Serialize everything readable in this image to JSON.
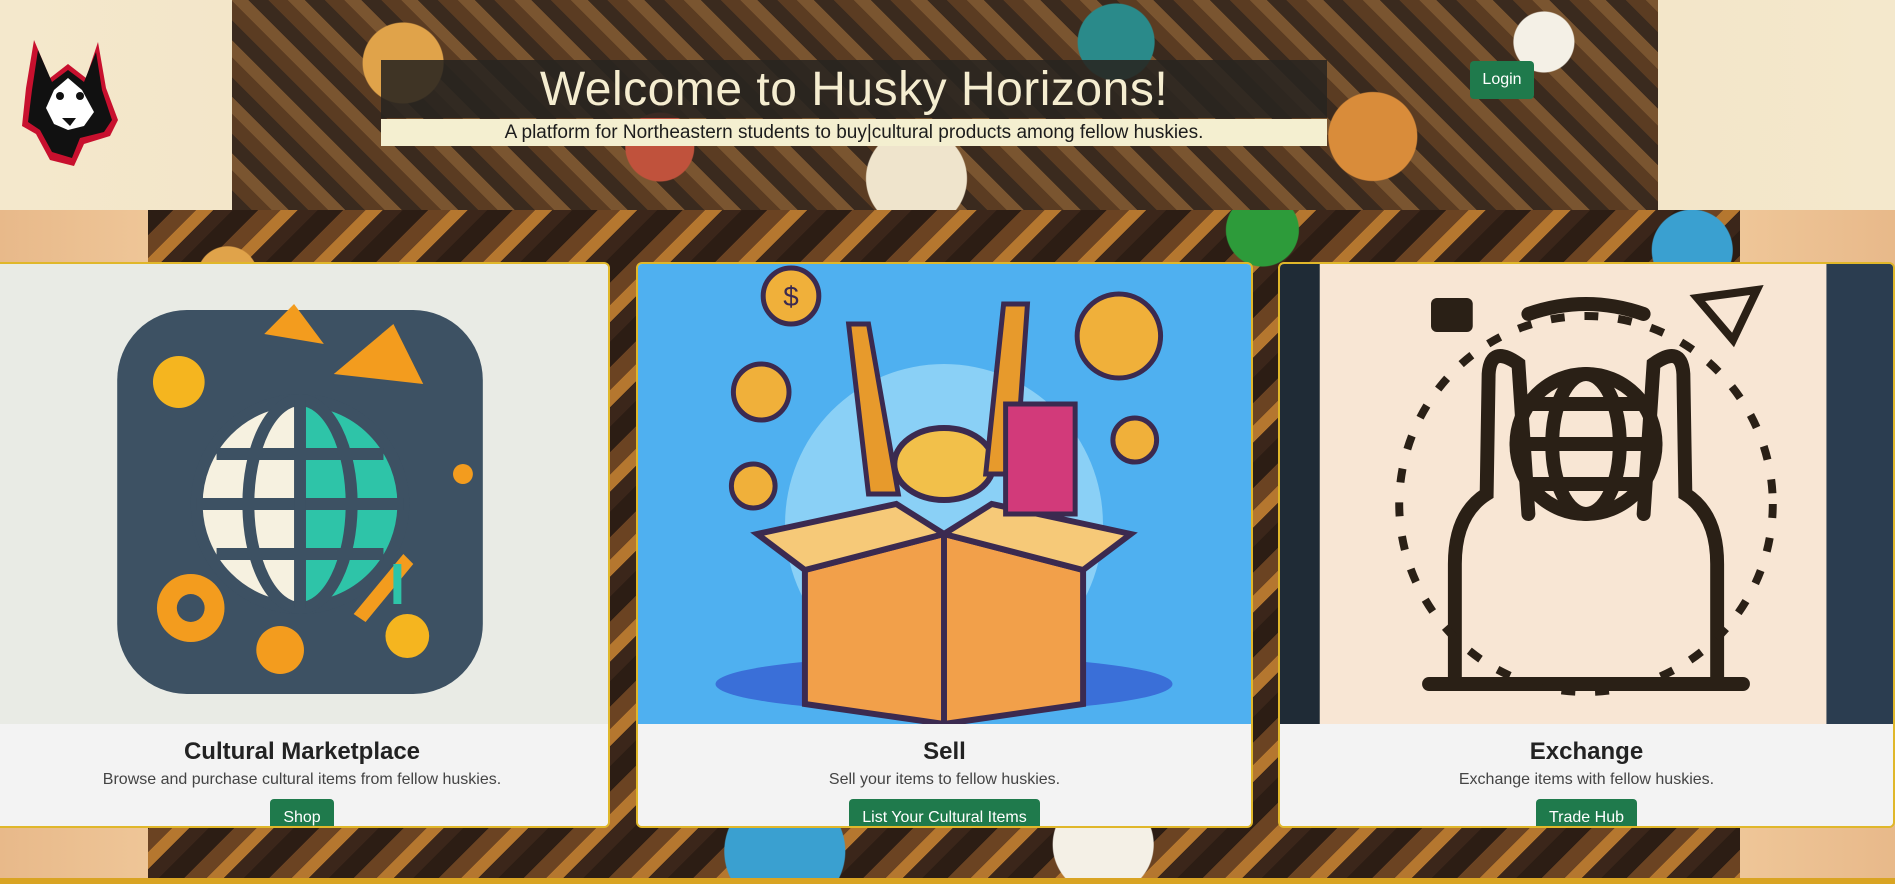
{
  "header": {
    "title": "Welcome to Husky Horizons!",
    "subtitle": "A platform for Northeastern students to buy|cultural products among fellow huskies.",
    "login_label": "Login",
    "logo_icon": "husky-logo-icon"
  },
  "cards": [
    {
      "title": "Cultural Marketplace",
      "description": "Browse and purchase cultural items from fellow huskies.",
      "button_label": "Shop",
      "icon": "globe-marketplace-icon"
    },
    {
      "title": "Sell",
      "description": "Sell your items to fellow huskies.",
      "button_label": "List Your Cultural Items",
      "icon": "cultural-box-icon"
    },
    {
      "title": "Exchange",
      "description": "Exchange items with fellow huskies.",
      "button_label": "Trade Hub",
      "icon": "hands-globe-icon"
    }
  ],
  "colors": {
    "button_green": "#1f7a4c",
    "card_border": "#e0b72a",
    "title_text": "#f5edd0"
  }
}
